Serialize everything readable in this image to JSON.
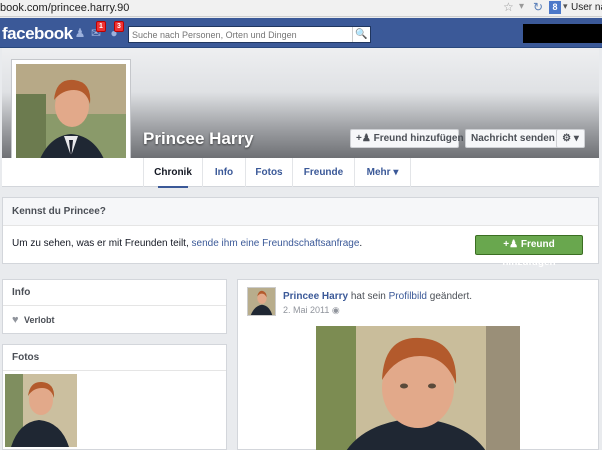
{
  "browser": {
    "url": "book.com/princee.harry.90",
    "user_label": "User na",
    "google_label": "8"
  },
  "topbar": {
    "logo": "facebook",
    "friend_badge": "1",
    "notif_badge": "3",
    "search_placeholder": "Suche nach Personen, Orten und Dingen"
  },
  "profile": {
    "name": "Princee Harry",
    "add_friend_label": "Freund hinzufügen",
    "message_label": "Nachricht senden",
    "gear_label": "⚙ ▾"
  },
  "tabs": [
    {
      "label": "Chronik"
    },
    {
      "label": "Info"
    },
    {
      "label": "Fotos"
    },
    {
      "label": "Freunde"
    },
    {
      "label": "Mehr"
    }
  ],
  "know": {
    "heading": "Kennst du Princee?",
    "text": "Um zu sehen, was er mit Freunden teilt,",
    "link": "sende ihm eine Freundschaftsanfrage",
    "suffix": ".",
    "button": "Freund hinzufügen"
  },
  "info_box": {
    "heading": "Info",
    "item": "Verlobt"
  },
  "fotos_box": {
    "heading": "Fotos"
  },
  "post": {
    "author": "Princee Harry",
    "action": "hat sein",
    "object": "Profilbild",
    "verb": "geändert.",
    "date": "2. Mai 2011"
  },
  "colors": {
    "brand": "#3b5998",
    "green_button": "#69a74e"
  }
}
